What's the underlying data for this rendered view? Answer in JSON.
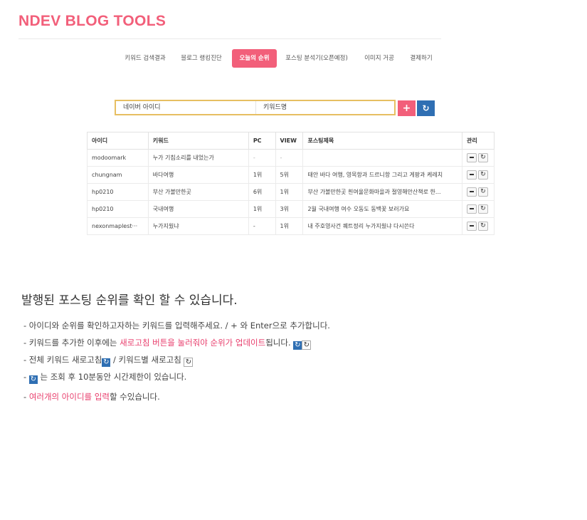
{
  "app": {
    "logo": "NDEV BLOG TOOLS"
  },
  "nav": {
    "items": [
      {
        "label": "키워드 검색결과"
      },
      {
        "label": "블로그 랭킹진단"
      },
      {
        "label": "오늘의 순위"
      },
      {
        "label": "포스팅 분석기(오픈예정)"
      },
      {
        "label": "이미지 거공"
      },
      {
        "label": "결제하기"
      }
    ],
    "active_index": 2
  },
  "search": {
    "id_placeholder": "네이버 아이디",
    "keyword_placeholder": "키워드명",
    "add_symbol": "+",
    "refresh_symbol": "↻"
  },
  "table": {
    "headers": [
      "아이디",
      "키워드",
      "PC",
      "VIEW",
      "포스팅제목",
      "관리"
    ],
    "rows": [
      {
        "id": "modoomark",
        "keyword": "누가 기침소리를 내었는가",
        "pc": "-",
        "view": "-",
        "title": ""
      },
      {
        "id": "chungnam",
        "keyword": "바다여행",
        "pc": "1위",
        "view": "5위",
        "title": "태안 바다 여행, 영목항과 드르니항 그리고 게팡과 케레치"
      },
      {
        "id": "hp0210",
        "keyword": "부산 가볼만한곳",
        "pc": "6위",
        "view": "1위",
        "title": "부산 가볼만한곳 흰여울문화마을과 절영해안산책로 한..."
      },
      {
        "id": "hp0210",
        "keyword": "국내여행",
        "pc": "1위",
        "view": "3위",
        "title": "2월 국내여행 여수 오동도 동백꽃 보러가요"
      },
      {
        "id": "nexonmaplest···",
        "keyword": "누가지웠냐",
        "pc": "-",
        "view": "1위",
        "title": "내 주호영사건 퀘트정리 누가지웠냐 다시쓴다"
      }
    ],
    "manage_minus": "−",
    "manage_refresh": "↻"
  },
  "info": {
    "title": "발행된 포스팅 순위를 확인 할 수 있습니다.",
    "line1": "- 아이디와 순위를 확인하고자하는 키워드를 입력해주세요.  /  + 와 Enter으로 추가합니다.",
    "line2_a": "- 키워드를 추가한 이후에는 ",
    "line2_highlight": "새로고침 버튼을 눌러줘야 순위가 업데이트",
    "line2_b": "됩니다.",
    "line3_a": "- 전체 키워드 새로고침",
    "line3_b": " / 키워드별 새로고침 ",
    "line4_a": "- ",
    "line4_b": " 는 조회 후 10분동안 시간제한이 있습니다.",
    "line5_a": "- ",
    "line5_highlight": "여러개의 아이디를 입력",
    "line5_b": "할 수있습니다.",
    "refresh_glyph": "↻"
  },
  "colors": {
    "accent": "#f25f7a",
    "blue": "#2f6fb3",
    "search_border": "#e7bf62",
    "highlight": "#e83e6c"
  }
}
